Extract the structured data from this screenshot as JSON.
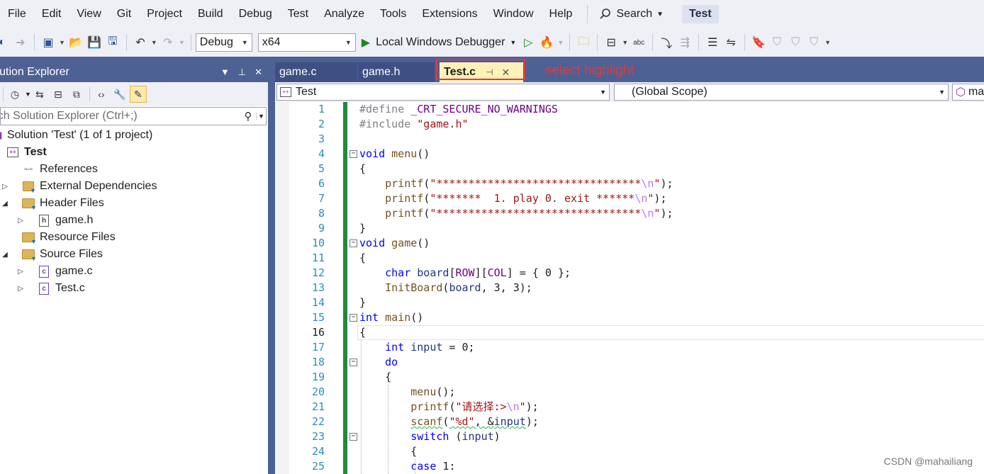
{
  "menubar": {
    "items": [
      "File",
      "Edit",
      "View",
      "Git",
      "Project",
      "Build",
      "Debug",
      "Test",
      "Analyze",
      "Tools",
      "Extensions",
      "Window",
      "Help"
    ],
    "search_label": "Search",
    "solution_badge": "Test"
  },
  "toolbar": {
    "configuration": "Debug",
    "platform": "x64",
    "run_label": "Local Windows Debugger"
  },
  "solution_explorer": {
    "title": "Solution Explorer",
    "search_placeholder": "Search Solution Explorer (Ctrl+;)",
    "tree": [
      {
        "label": "Solution 'Test' (1 of 1 project)",
        "level": 0,
        "expander": "",
        "icon": "solution-icon",
        "bold": false
      },
      {
        "label": "Test",
        "level": 1,
        "expander": "",
        "icon": "project-icon",
        "bold": true
      },
      {
        "label": "References",
        "level": 2,
        "expander": "",
        "icon": "references-icon",
        "bold": false
      },
      {
        "label": "External Dependencies",
        "level": 2,
        "expander": "collapsed",
        "icon": "external-deps-icon",
        "bold": false
      },
      {
        "label": "Header Files",
        "level": 2,
        "expander": "expanded",
        "icon": "folder-icon",
        "bold": false
      },
      {
        "label": "game.h",
        "level": 3,
        "expander": "collapsed",
        "icon": "header-file-icon",
        "bold": false
      },
      {
        "label": "Resource Files",
        "level": 2,
        "expander": "",
        "icon": "folder-icon",
        "bold": false
      },
      {
        "label": "Source Files",
        "level": 2,
        "expander": "expanded",
        "icon": "folder-icon",
        "bold": false
      },
      {
        "label": "game.c",
        "level": 3,
        "expander": "collapsed",
        "icon": "c-file-icon",
        "bold": false
      },
      {
        "label": "Test.c",
        "level": 3,
        "expander": "collapsed",
        "icon": "c-file-icon",
        "bold": false
      }
    ]
  },
  "tabs": [
    {
      "label": "game.c",
      "active": false
    },
    {
      "label": "game.h",
      "active": false
    },
    {
      "label": "Test.c",
      "active": true
    }
  ],
  "annotation": "select highlight",
  "navbar": {
    "project": "Test",
    "scope": "(Global Scope)",
    "member": "ma"
  },
  "editor": {
    "current_line": 16,
    "lines": [
      {
        "n": 1,
        "fold": "",
        "code": "#define _CRT_SECURE_NO_WARNINGS"
      },
      {
        "n": 2,
        "fold": "",
        "code": "#include \"game.h\""
      },
      {
        "n": 3,
        "fold": "",
        "code": ""
      },
      {
        "n": 4,
        "fold": "minus",
        "code": "void menu()"
      },
      {
        "n": 5,
        "fold": "",
        "code": "{"
      },
      {
        "n": 6,
        "fold": "",
        "code": "    printf(\"********************************\\n\");"
      },
      {
        "n": 7,
        "fold": "",
        "code": "    printf(\"*******  1. play 0. exit ******\\n\");"
      },
      {
        "n": 8,
        "fold": "",
        "code": "    printf(\"********************************\\n\");"
      },
      {
        "n": 9,
        "fold": "",
        "code": "}"
      },
      {
        "n": 10,
        "fold": "minus",
        "code": "void game()"
      },
      {
        "n": 11,
        "fold": "",
        "code": "{"
      },
      {
        "n": 12,
        "fold": "",
        "code": "    char board[ROW][COL] = { 0 };"
      },
      {
        "n": 13,
        "fold": "",
        "code": "    InitBoard(board, 3, 3);"
      },
      {
        "n": 14,
        "fold": "",
        "code": "}"
      },
      {
        "n": 15,
        "fold": "minus",
        "code": "int main()"
      },
      {
        "n": 16,
        "fold": "",
        "code": "{"
      },
      {
        "n": 17,
        "fold": "",
        "code": "    int input = 0;"
      },
      {
        "n": 18,
        "fold": "minus",
        "code": "    do"
      },
      {
        "n": 19,
        "fold": "",
        "code": "    {"
      },
      {
        "n": 20,
        "fold": "",
        "code": "        menu();"
      },
      {
        "n": 21,
        "fold": "",
        "code": "        printf(\"请选择:>\\n\");"
      },
      {
        "n": 22,
        "fold": "",
        "code": "        scanf(\"%d\", &input);"
      },
      {
        "n": 23,
        "fold": "minus",
        "code": "        switch (input)"
      },
      {
        "n": 24,
        "fold": "",
        "code": "        {"
      },
      {
        "n": 25,
        "fold": "",
        "code": "        case 1:"
      }
    ]
  },
  "watermark": "CSDN @mahailiang",
  "colors": {
    "accent_title": "#4d6194",
    "active_tab": "#fff1b8",
    "highlight_box": "#e03a3a",
    "change_bar": "#1f8a3e",
    "line_number": "#2b91af"
  }
}
